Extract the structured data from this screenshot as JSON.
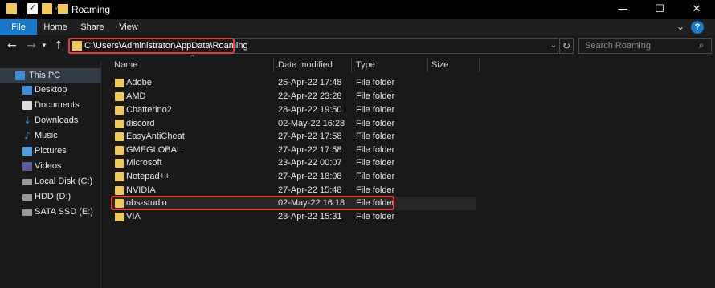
{
  "window": {
    "title": "Roaming",
    "controls": {
      "minimize": "—",
      "maximize": "☐",
      "close": "✕"
    }
  },
  "ribbon": {
    "tabs": [
      "File",
      "Home",
      "Share",
      "View"
    ],
    "expand_glyph": "⌄",
    "help_glyph": "?"
  },
  "navigation": {
    "back_glyph": "←",
    "forward_glyph": "→",
    "recent_glyph": "▾",
    "up_glyph": "↑",
    "address": "C:\\Users\\Administrator\\AppData\\Roaming",
    "address_drop_glyph": "⌄",
    "refresh_glyph": "↻",
    "search_placeholder": "Search Roaming",
    "search_glyph": "⌕"
  },
  "nav_pane": {
    "items": [
      {
        "label": "This PC",
        "icon": "this-pc-icon",
        "selected": true
      },
      {
        "label": "Desktop",
        "icon": "desktop-icon"
      },
      {
        "label": "Documents",
        "icon": "documents-icon"
      },
      {
        "label": "Downloads",
        "icon": "downloads-icon"
      },
      {
        "label": "Music",
        "icon": "music-icon"
      },
      {
        "label": "Pictures",
        "icon": "pictures-icon"
      },
      {
        "label": "Videos",
        "icon": "videos-icon"
      },
      {
        "label": "Local Disk (C:)",
        "icon": "drive-icon"
      },
      {
        "label": "HDD (D:)",
        "icon": "drive-icon"
      },
      {
        "label": "SATA SSD (E:)",
        "icon": "drive-icon"
      }
    ]
  },
  "file_list": {
    "columns": {
      "name": "Name",
      "date": "Date modified",
      "type": "Type",
      "size": "Size"
    },
    "sort_glyph": "^",
    "rows": [
      {
        "name": "Adobe",
        "date": "25-Apr-22 17:48",
        "type": "File folder"
      },
      {
        "name": "AMD",
        "date": "22-Apr-22 23:28",
        "type": "File folder"
      },
      {
        "name": "Chatterino2",
        "date": "28-Apr-22 19:50",
        "type": "File folder"
      },
      {
        "name": "discord",
        "date": "02-May-22 16:28",
        "type": "File folder"
      },
      {
        "name": "EasyAntiCheat",
        "date": "27-Apr-22 17:58",
        "type": "File folder"
      },
      {
        "name": "GMEGLOBAL",
        "date": "27-Apr-22 17:58",
        "type": "File folder"
      },
      {
        "name": "Microsoft",
        "date": "23-Apr-22 00:07",
        "type": "File folder"
      },
      {
        "name": "Notepad++",
        "date": "27-Apr-22 18:08",
        "type": "File folder"
      },
      {
        "name": "NVIDIA",
        "date": "27-Apr-22 15:48",
        "type": "File folder"
      },
      {
        "name": "obs-studio",
        "date": "02-May-22 16:18",
        "type": "File folder"
      },
      {
        "name": "VIA",
        "date": "28-Apr-22 15:31",
        "type": "File folder"
      }
    ]
  },
  "colors": {
    "accent": "#1979ca",
    "highlight": "#e23c3c",
    "folder": "#f1c85a"
  }
}
